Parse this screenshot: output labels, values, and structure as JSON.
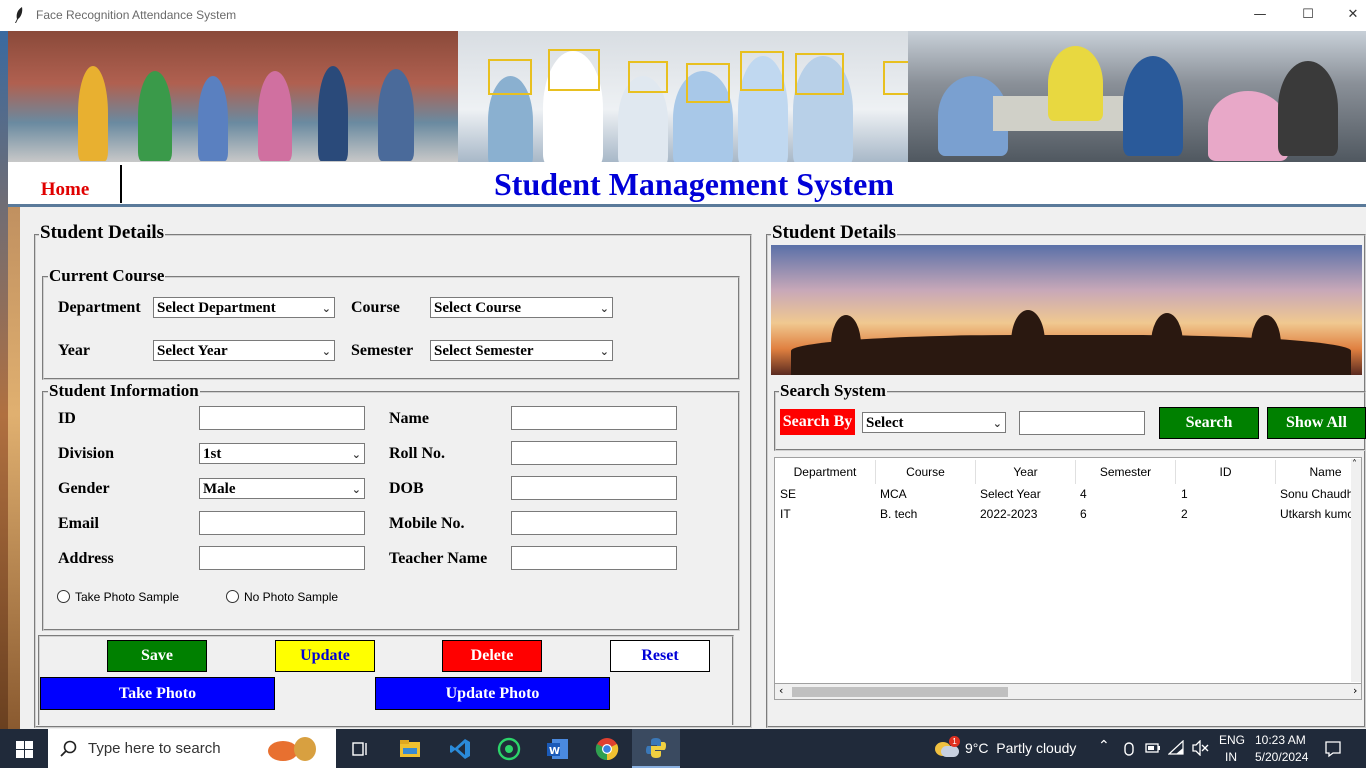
{
  "window": {
    "title": "Face Recognition Attendance System"
  },
  "header": {
    "home_label": "Home",
    "app_title": "Student Management System"
  },
  "left_panel": {
    "title": "Student Details",
    "current_course": {
      "title": "Current Course",
      "department_label": "Department",
      "department_value": "Select Department",
      "course_label": "Course",
      "course_value": "Select Course",
      "year_label": "Year",
      "year_value": "Select Year",
      "semester_label": "Semester",
      "semester_value": "Select Semester"
    },
    "student_info": {
      "title": "Student Information",
      "id_label": "ID",
      "id_value": "",
      "name_label": "Name",
      "name_value": "",
      "division_label": "Division",
      "division_value": "1st",
      "roll_label": "Roll No.",
      "roll_value": "",
      "gender_label": "Gender",
      "gender_value": "Male",
      "dob_label": "DOB",
      "dob_value": "",
      "email_label": "Email",
      "email_value": "",
      "mobile_label": "Mobile No.",
      "mobile_value": "",
      "address_label": "Address",
      "address_value": "",
      "teacher_label": "Teacher Name",
      "teacher_value": "",
      "radio_take": "Take Photo Sample",
      "radio_no": "No Photo Sample"
    },
    "buttons": {
      "save": "Save",
      "update": "Update",
      "delete": "Delete",
      "reset": "Reset",
      "take_photo": "Take Photo",
      "update_photo": "Update Photo"
    }
  },
  "right_panel": {
    "title": "Student Details",
    "search": {
      "title": "Search System",
      "search_by_label": "Search By",
      "select_value": "Select",
      "search_text": "",
      "search_button": "Search",
      "show_all_button": "Show All"
    },
    "table": {
      "columns": [
        "Department",
        "Course",
        "Year",
        "Semester",
        "ID",
        "Name"
      ],
      "rows": [
        [
          "SE",
          "MCA",
          "Select Year",
          "4",
          "1",
          "Sonu Chaudh"
        ],
        [
          "IT",
          "B. tech",
          "2022-2023",
          "6",
          "2",
          "Utkarsh kumc"
        ]
      ]
    }
  },
  "taskbar": {
    "search_placeholder": "Type here to search",
    "weather": "9°C  Partly cloudy",
    "weather_badge": "1",
    "lang_top": "ENG",
    "lang_bottom": "IN",
    "time": "10:23 AM",
    "date": "5/20/2024"
  },
  "colors": {
    "title_blue": "#0000d8",
    "home_red": "#e00000",
    "save_green": "#008000",
    "update_yellow": "#ffff00",
    "delete_red": "#ff0000",
    "photo_blue": "#0000ff"
  }
}
